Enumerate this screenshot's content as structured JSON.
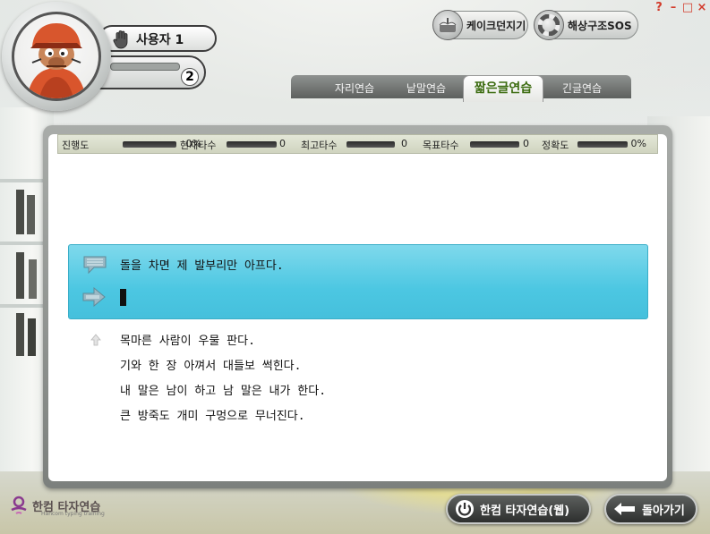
{
  "window_controls": {
    "help": "?",
    "minimize": "–",
    "maximize": "□",
    "close": "×"
  },
  "profile": {
    "name": "사용자 1",
    "level": "2"
  },
  "games": {
    "cake": {
      "label": "케이크던지기",
      "icon": "cake-icon"
    },
    "rescue": {
      "label": "해상구조SOS",
      "icon": "lifebuoy-icon"
    }
  },
  "tabs": [
    {
      "label": "자리연습",
      "active": false
    },
    {
      "label": "낱말연습",
      "active": false
    },
    {
      "label": "짧은글연습",
      "active": true
    },
    {
      "label": "긴글연습",
      "active": false
    }
  ],
  "stats": {
    "progress": {
      "label": "진행도",
      "value": "0%"
    },
    "current_speed": {
      "label": "현재타수",
      "value": "0"
    },
    "max_speed": {
      "label": "최고타수",
      "value": "0"
    },
    "target_speed": {
      "label": "목표타수",
      "value": "0"
    },
    "accuracy": {
      "label": "정확도",
      "value": "0%"
    }
  },
  "practice": {
    "current_sentence": "돌을 차면 제 발부리만 아프다.",
    "input_value": "",
    "upcoming": [
      "목마른 사람이 우물 판다.",
      "기와 한 장 아껴서 대들보 썩힌다.",
      "내 말은 남이 하고 남 말은 내가 한다.",
      "큰 방죽도 개미 구멍으로 무너진다."
    ]
  },
  "footer": {
    "logo_text": "한컴 타자연습",
    "logo_sub": "Hancom typing training",
    "web_button": "한컴 타자연습(웹)",
    "back_button": "돌아가기"
  },
  "colors": {
    "active_tab_text": "#3b6b0f",
    "typing_box": "#4cc7e2",
    "close_button": "#d23a2a"
  }
}
